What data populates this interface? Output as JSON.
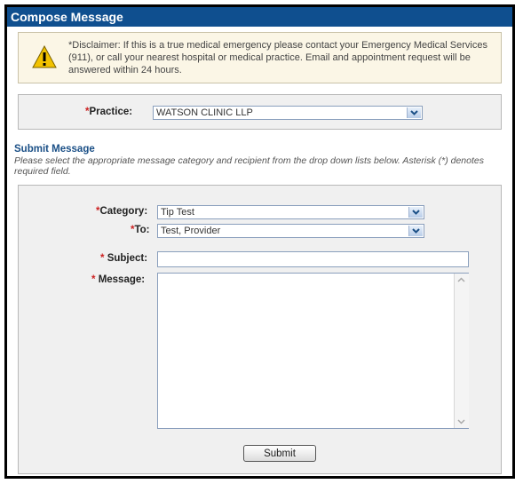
{
  "window": {
    "title": "Compose Message"
  },
  "disclaimer": {
    "icon": "warning-icon",
    "text": "*Disclaimer: If this is a true medical emergency please contact your Emergency Medical Services (911), or call your nearest hospital or medical practice. Email and appointment request will be answered within 24 hours."
  },
  "practice": {
    "required_mark": "*",
    "label": "Practice:",
    "value": "WATSON CLINIC LLP"
  },
  "submit_section": {
    "heading": "Submit Message",
    "description": "Please select the appropriate message category and recipient from the drop down lists below. Asterisk (*) denotes required field."
  },
  "form": {
    "category": {
      "required_mark": "*",
      "label": "Category:",
      "value": "Tip Test"
    },
    "to": {
      "required_mark": "*",
      "label": "To:",
      "value": "Test, Provider"
    },
    "subject": {
      "required_mark": "*",
      "label": "Subject:",
      "value": ""
    },
    "message": {
      "required_mark": "*",
      "label": "Message:",
      "value": ""
    },
    "submit_label": "Submit"
  },
  "colors": {
    "titlebar": "#0f4f8f",
    "heading": "#1a4f86",
    "required": "#cc2222",
    "warning": "#f2c200"
  }
}
